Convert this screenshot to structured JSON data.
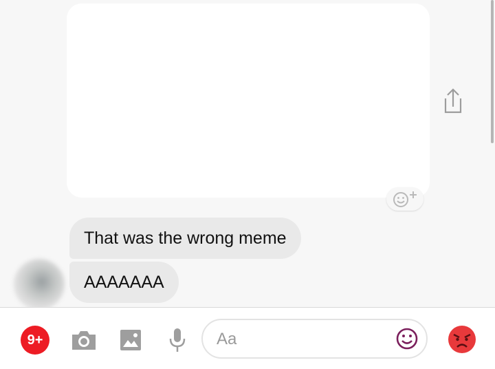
{
  "messages": [
    {
      "text": "That was the wrong meme"
    },
    {
      "text": "AAAAAAA"
    }
  ],
  "composer": {
    "badge": "9+",
    "input_placeholder": "Aa"
  },
  "icons": {
    "share": "share-icon",
    "react": "add-reaction-icon",
    "camera": "camera-icon",
    "gallery": "gallery-icon",
    "mic": "microphone-icon",
    "emoji": "emoji-icon",
    "quick_reaction": "angry-face-icon"
  },
  "colors": {
    "badge": "#ed1c24",
    "emoji_accent": "#7b1f5c",
    "angry_face": "#e8393b",
    "bubble": "#e9e9e9"
  }
}
